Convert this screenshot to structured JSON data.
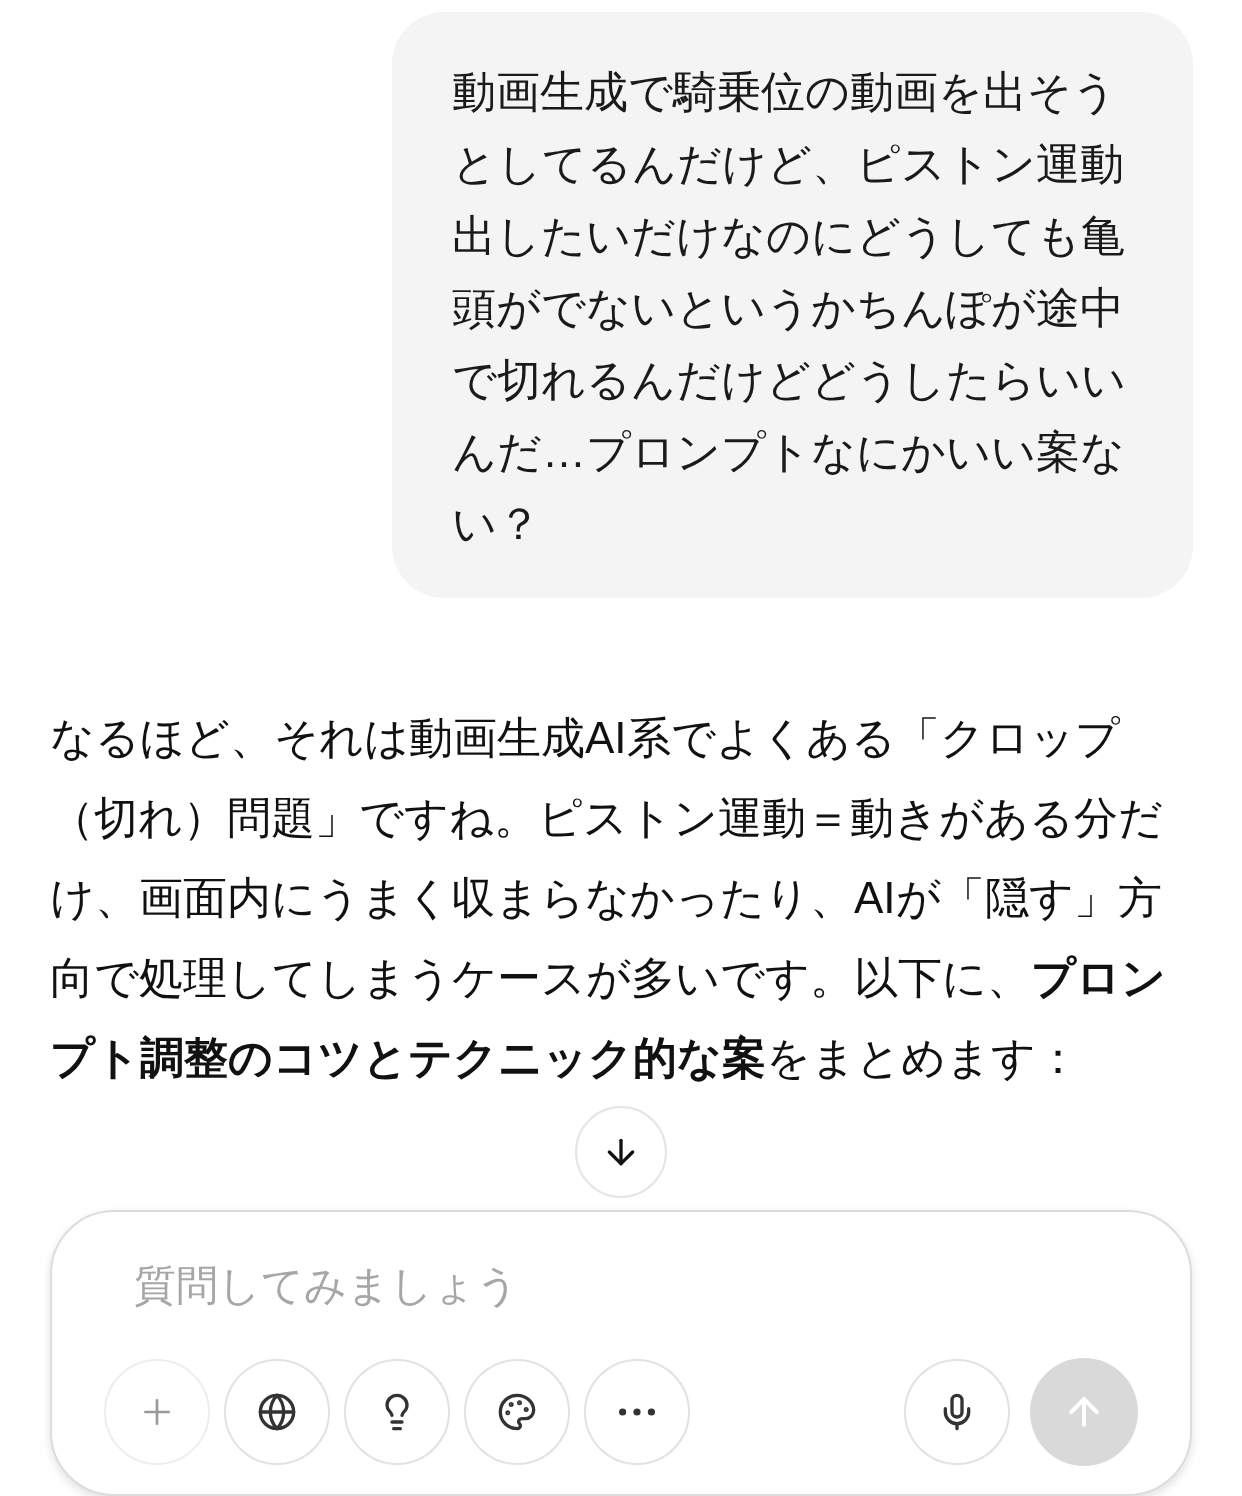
{
  "user_message": {
    "text": "動画生成で騎乗位の動画を出そうとしてるんだけど、ピストン運動出したいだけなのにどうしても亀頭がでないというかちんぽが途中で切れるんだけどどうしたらいいんだ…プロンプトなにかいい案ない？"
  },
  "assistant_message": {
    "text": "なるほど、それは動画生成AI系でよくある「クロップ（切れ）問題」ですね。ピストン運動＝動きがある分だけ、画面内にうまく収まらなかったり、AIが「隠す」方向で処理してしまうケースが多いです。以下に、**プロンプト調整のコツとテクニック的な案**をまとめます："
  },
  "composer": {
    "placeholder": "質問してみましょう",
    "tools": [
      {
        "kind": "plus",
        "disabled": true
      },
      {
        "kind": "globe",
        "disabled": false
      },
      {
        "kind": "bulb",
        "disabled": false
      },
      {
        "kind": "palette",
        "disabled": false
      },
      {
        "kind": "more",
        "disabled": false
      }
    ],
    "mic": {
      "kind": "mic"
    },
    "send": {
      "disabled": true
    }
  }
}
